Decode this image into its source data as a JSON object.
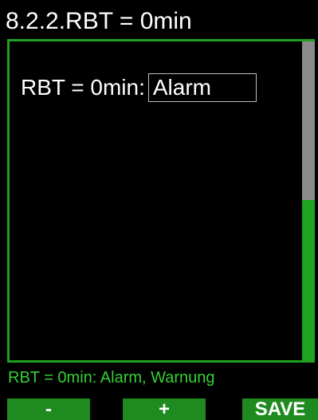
{
  "title": "8.2.2.RBT = 0min",
  "setting": {
    "label": "RBT = 0min:",
    "value": "Alarm"
  },
  "status_text": "RBT = 0min: Alarm, Warnung",
  "softkeys": {
    "minus": "-",
    "plus": "+",
    "save": "SAVE"
  },
  "scroll": {
    "position_fraction": 0.5
  },
  "colors": {
    "background": "#000000",
    "accent_green": "#1fa01f",
    "status_green": "#35d035",
    "scroll_grey": "#8a8a8a",
    "text": "#ffffff"
  }
}
